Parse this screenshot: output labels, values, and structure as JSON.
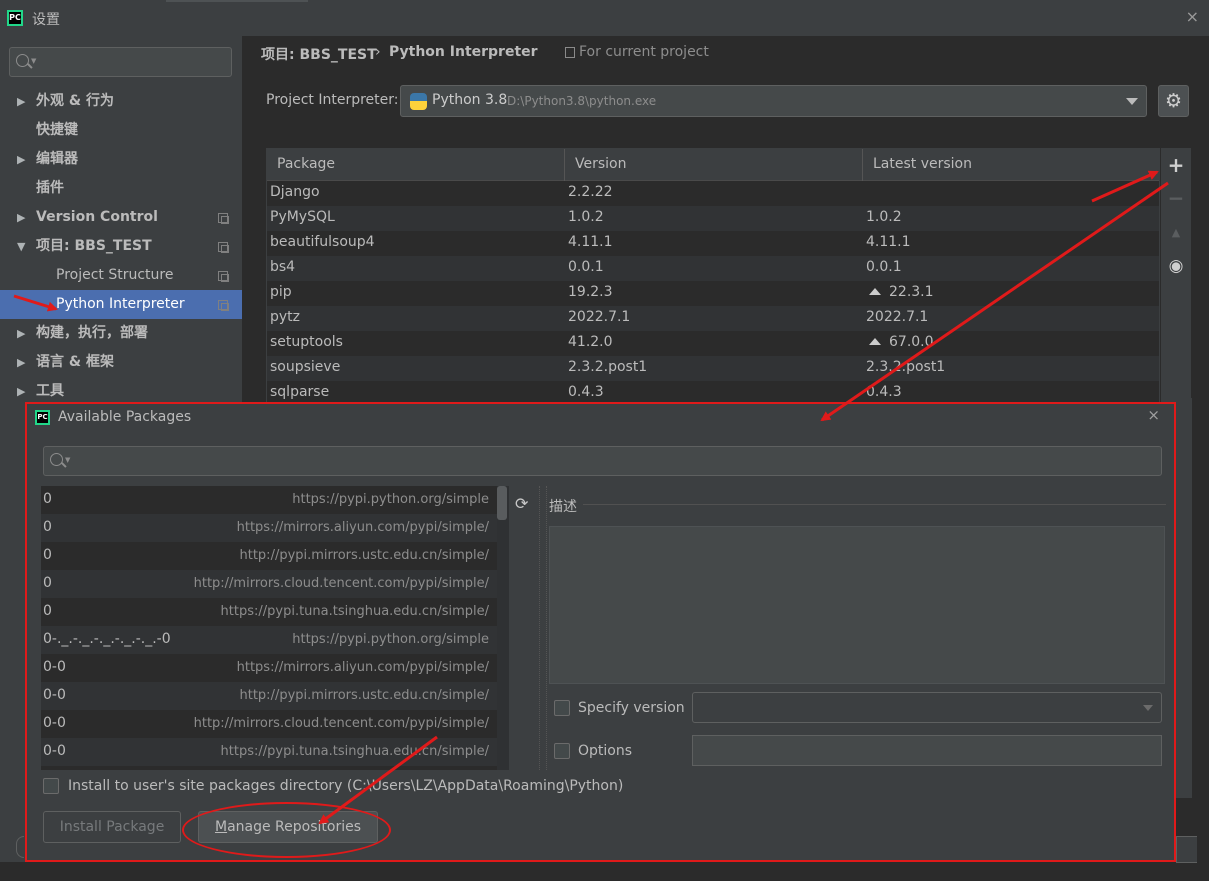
{
  "window": {
    "title": "设置",
    "close": "×"
  },
  "sidebar": {
    "items": [
      {
        "label": "外观 & 行为",
        "arrow": "▶"
      },
      {
        "label": "快捷键",
        "arrow": ""
      },
      {
        "label": "编辑器",
        "arrow": "▶"
      },
      {
        "label": "插件",
        "arrow": ""
      },
      {
        "label": "Version Control",
        "arrow": "▶"
      },
      {
        "label": "项目: BBS_TEST",
        "arrow": "▼"
      },
      {
        "label": "Project Structure",
        "arrow": ""
      },
      {
        "label": "Python Interpreter",
        "arrow": "",
        "selected": true
      },
      {
        "label": "构建，执行，部署",
        "arrow": "▶"
      },
      {
        "label": "语言 & 框架",
        "arrow": "▶"
      },
      {
        "label": "工具",
        "arrow": "▶"
      }
    ]
  },
  "header": {
    "crumb_project": "项目: BBS_TEST",
    "crumb_sep": "›",
    "crumb_page": "Python Interpreter",
    "for_current_project": "For current project"
  },
  "interpreter": {
    "label": "Project Interpreter:",
    "name": "Python 3.8",
    "path": "D:\\Python3.8\\python.exe",
    "gear": "⚙"
  },
  "packages": {
    "columns": [
      "Package",
      "Version",
      "Latest version"
    ],
    "rows": [
      {
        "name": "Django",
        "version": "2.2.22",
        "latest": "",
        "upgrade": false
      },
      {
        "name": "PyMySQL",
        "version": "1.0.2",
        "latest": "1.0.2",
        "upgrade": false
      },
      {
        "name": "beautifulsoup4",
        "version": "4.11.1",
        "latest": "4.11.1",
        "upgrade": false
      },
      {
        "name": "bs4",
        "version": "0.0.1",
        "latest": "0.0.1",
        "upgrade": false
      },
      {
        "name": "pip",
        "version": "19.2.3",
        "latest": "22.3.1",
        "upgrade": true
      },
      {
        "name": "pytz",
        "version": "2022.7.1",
        "latest": "2022.7.1",
        "upgrade": false
      },
      {
        "name": "setuptools",
        "version": "41.2.0",
        "latest": "67.0.0",
        "upgrade": true
      },
      {
        "name": "soupsieve",
        "version": "2.3.2.post1",
        "latest": "2.3.2.post1",
        "upgrade": false
      },
      {
        "name": "sqlparse",
        "version": "0.4.3",
        "latest": "0.4.3",
        "upgrade": false
      }
    ],
    "tools": {
      "add": "+",
      "remove": "−",
      "up": "▲",
      "eye": "◉"
    }
  },
  "dialog": {
    "title": "Available Packages",
    "close": "×",
    "repos": [
      {
        "name": "0",
        "url": "https://pypi.python.org/simple"
      },
      {
        "name": "0",
        "url": "https://mirrors.aliyun.com/pypi/simple/"
      },
      {
        "name": "0",
        "url": "http://pypi.mirrors.ustc.edu.cn/simple/"
      },
      {
        "name": "0",
        "url": "http://mirrors.cloud.tencent.com/pypi/simple/"
      },
      {
        "name": "0",
        "url": "https://pypi.tuna.tsinghua.edu.cn/simple/"
      },
      {
        "name": "0-._.-._.-._.-._.-._.-0",
        "url": "https://pypi.python.org/simple"
      },
      {
        "name": "0-0",
        "url": "https://mirrors.aliyun.com/pypi/simple/"
      },
      {
        "name": "0-0",
        "url": "http://pypi.mirrors.ustc.edu.cn/simple/"
      },
      {
        "name": "0-0",
        "url": "http://mirrors.cloud.tencent.com/pypi/simple/"
      },
      {
        "name": "0-0",
        "url": "https://pypi.tuna.tsinghua.edu.cn/simple/"
      }
    ],
    "refresh": "⟳",
    "description_label": "描述",
    "specify_version_label": "Specify version",
    "options_label": "Options",
    "install_user_label": "Install to user's site packages directory (C:\\Users\\LZ\\AppData\\Roaming\\Python)",
    "install_button": "Install Package",
    "manage_button_mnemonic": "M",
    "manage_button_rest": "anage Repositories"
  },
  "annotation": {
    "color": "#e01a1a"
  }
}
